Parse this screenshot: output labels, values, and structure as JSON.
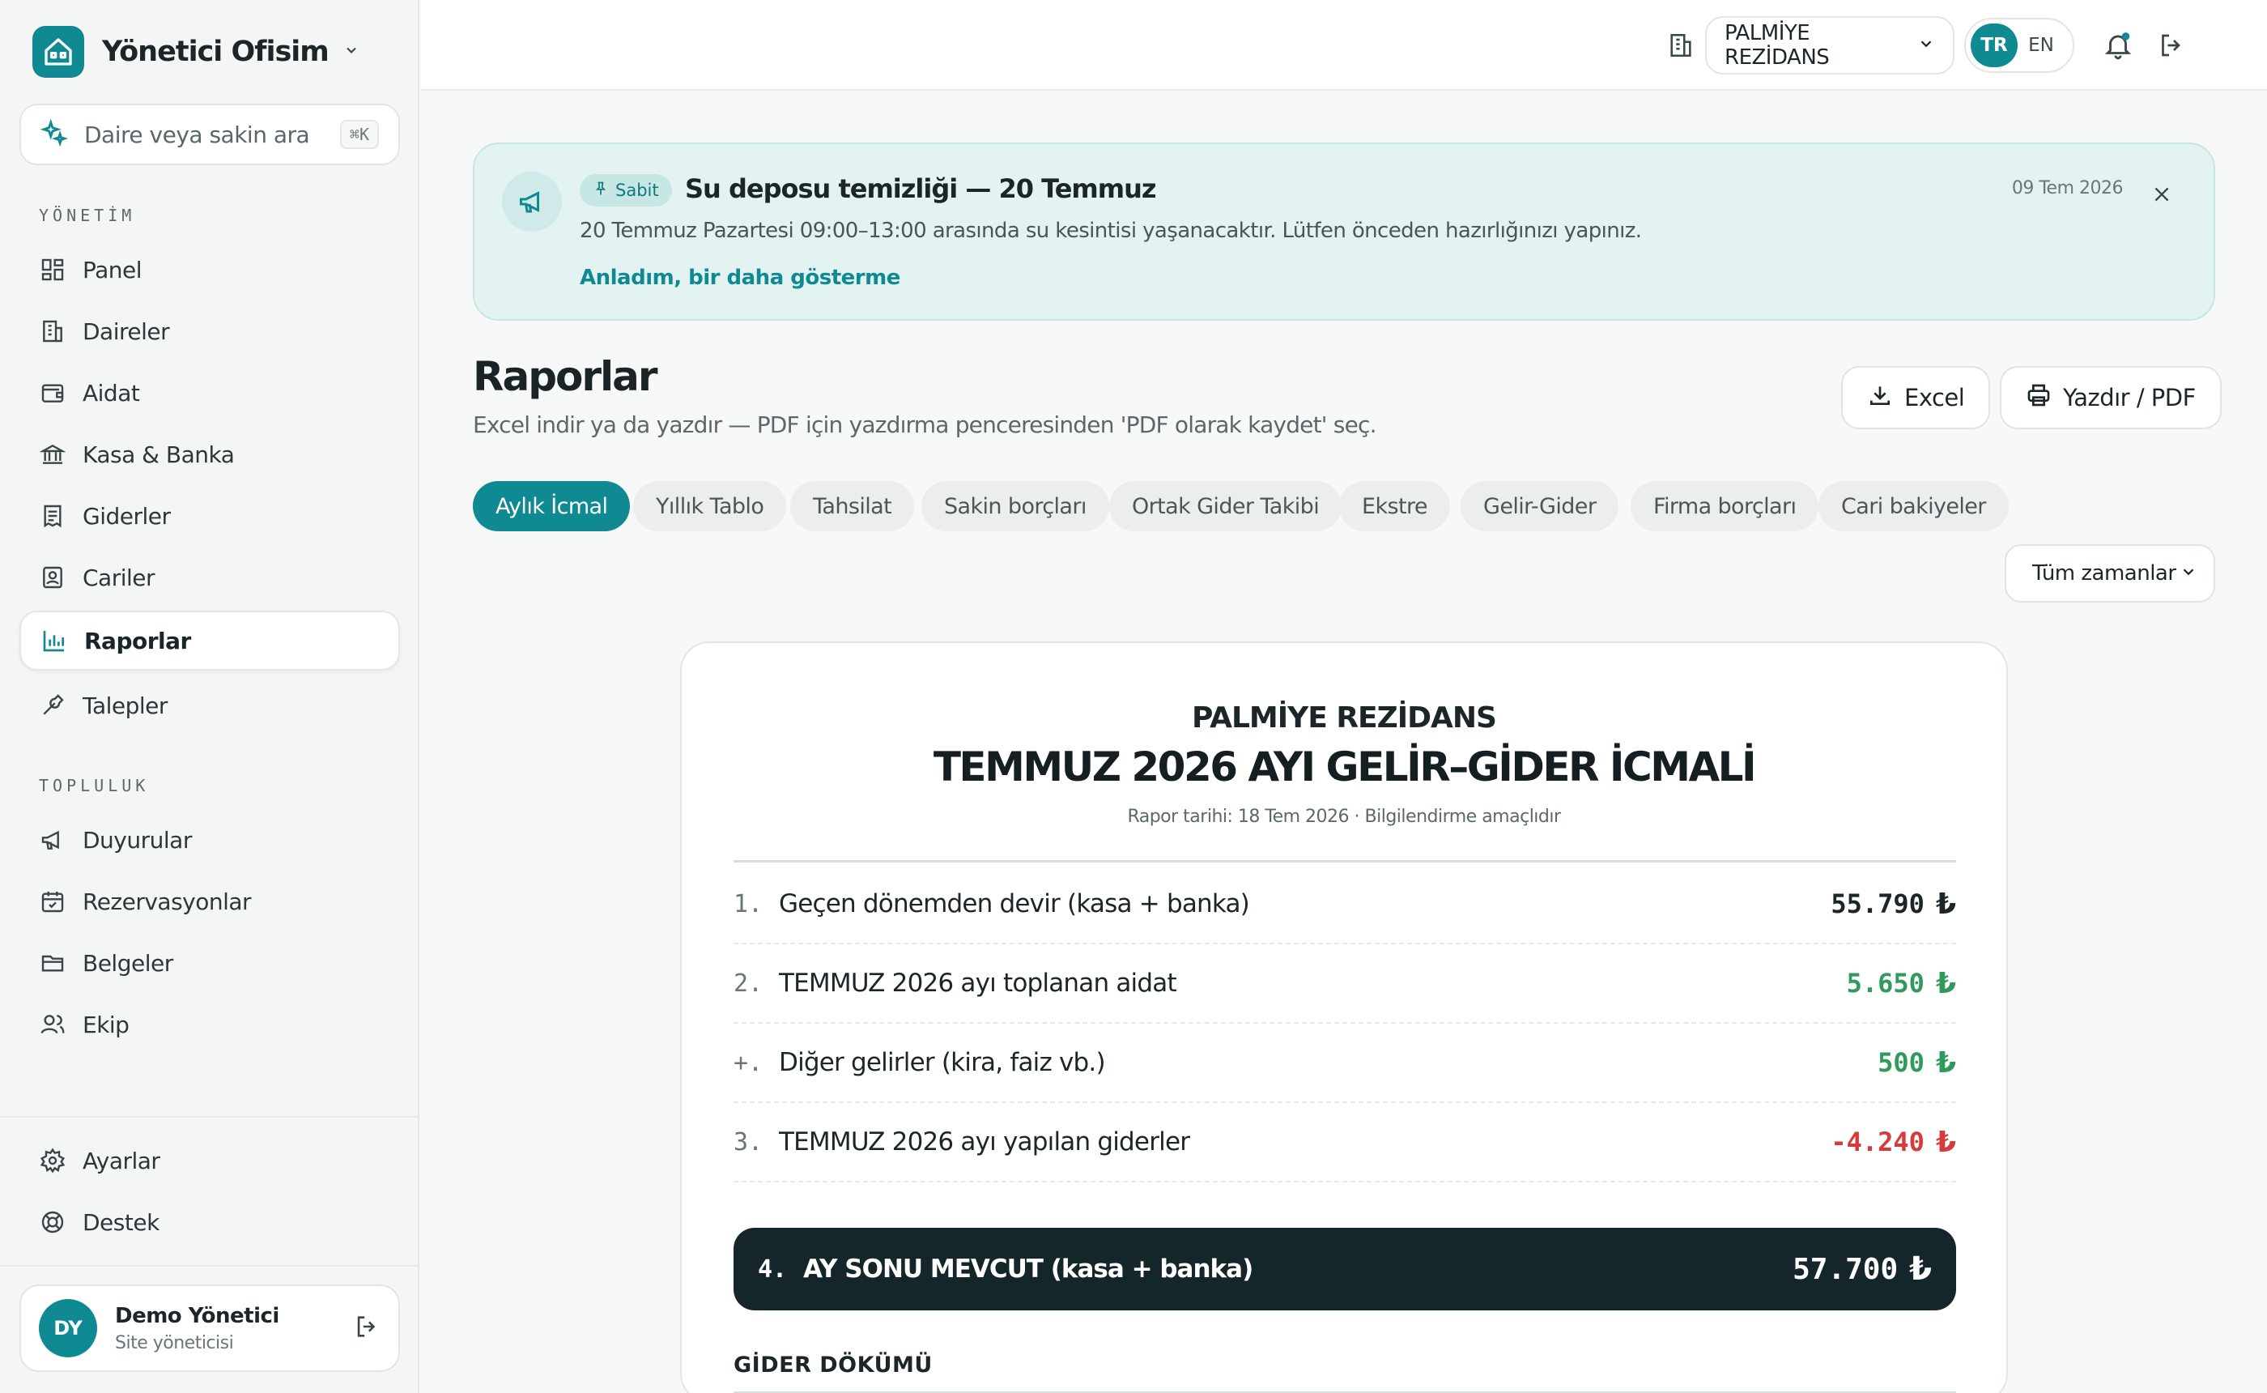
{
  "brand": {
    "name": "Yönetici Ofisim"
  },
  "search": {
    "placeholder": "Daire veya sakin ara",
    "shortcut": "⌘K"
  },
  "sidebar": {
    "section_management": "YÖNETİM",
    "section_community": "TOPLULUK",
    "items": [
      {
        "label": "Panel"
      },
      {
        "label": "Daireler"
      },
      {
        "label": "Aidat"
      },
      {
        "label": "Kasa & Banka"
      },
      {
        "label": "Giderler"
      },
      {
        "label": "Cariler"
      },
      {
        "label": "Raporlar"
      },
      {
        "label": "Talepler"
      },
      {
        "label": "Duyurular"
      },
      {
        "label": "Rezervasyonlar"
      },
      {
        "label": "Belgeler"
      },
      {
        "label": "Ekip"
      },
      {
        "label": "Ayarlar"
      },
      {
        "label": "Destek"
      }
    ]
  },
  "user": {
    "initials": "DY",
    "name": "Demo Yönetici",
    "role": "Site yöneticisi"
  },
  "topbar": {
    "site_name": "PALMİYE REZİDANS",
    "lang_tr": "TR",
    "lang_en": "EN"
  },
  "notice": {
    "badge": "Sabit",
    "title": "Su deposu temizliği — 20 Temmuz",
    "date": "09 Tem 2026",
    "body": "20 Temmuz Pazartesi 09:00–13:00 arasında su kesintisi yaşanacaktır. Lütfen önceden hazırlığınızı yapınız.",
    "link": "Anladım, bir daha gösterme"
  },
  "page": {
    "title": "Raporlar",
    "subtitle": "Excel indir ya da yazdır — PDF için yazdırma penceresinden 'PDF olarak kaydet' seç.",
    "excel_label": "Excel",
    "print_label": "Yazdır / PDF"
  },
  "tabs": [
    {
      "label": "Aylık İcmal"
    },
    {
      "label": "Yıllık Tablo"
    },
    {
      "label": "Tahsilat"
    },
    {
      "label": "Sakin borçları"
    },
    {
      "label": "Ortak Gider Takibi"
    },
    {
      "label": "Ekstre"
    },
    {
      "label": "Gelir-Gider"
    },
    {
      "label": "Firma borçları"
    },
    {
      "label": "Cari bakiyeler"
    }
  ],
  "period": {
    "selected": "Tüm zamanlar"
  },
  "report": {
    "site": "PALMİYE REZİDANS",
    "title": "TEMMUZ 2026 AYI GELİR–GİDER İCMALİ",
    "meta": "Rapor tarihi: 18 Tem 2026 · Bilgilendirme amaçlıdır",
    "currency": "₺",
    "rows": [
      {
        "num": "1.",
        "label": "Geçen dönemden devir (kasa + banka)",
        "value": "55.790"
      },
      {
        "num": "2.",
        "label": "TEMMUZ 2026 ayı toplanan aidat",
        "value": "5.650"
      },
      {
        "num": "+.",
        "label": "Diğer gelirler (kira, faiz vb.)",
        "value": "500"
      },
      {
        "num": "3.",
        "label": "TEMMUZ 2026 ayı yapılan giderler",
        "value": "-4.240"
      }
    ],
    "total": {
      "num": "4.",
      "label": "AY SONU MEVCUT (kasa + banka)",
      "value": "57.700"
    },
    "section": "GİDER DÖKÜMÜ"
  },
  "colors": {
    "accent": "#0f8a93",
    "positive": "#2f9a5c",
    "negative": "#d63a3a",
    "dark": "#15262b"
  }
}
